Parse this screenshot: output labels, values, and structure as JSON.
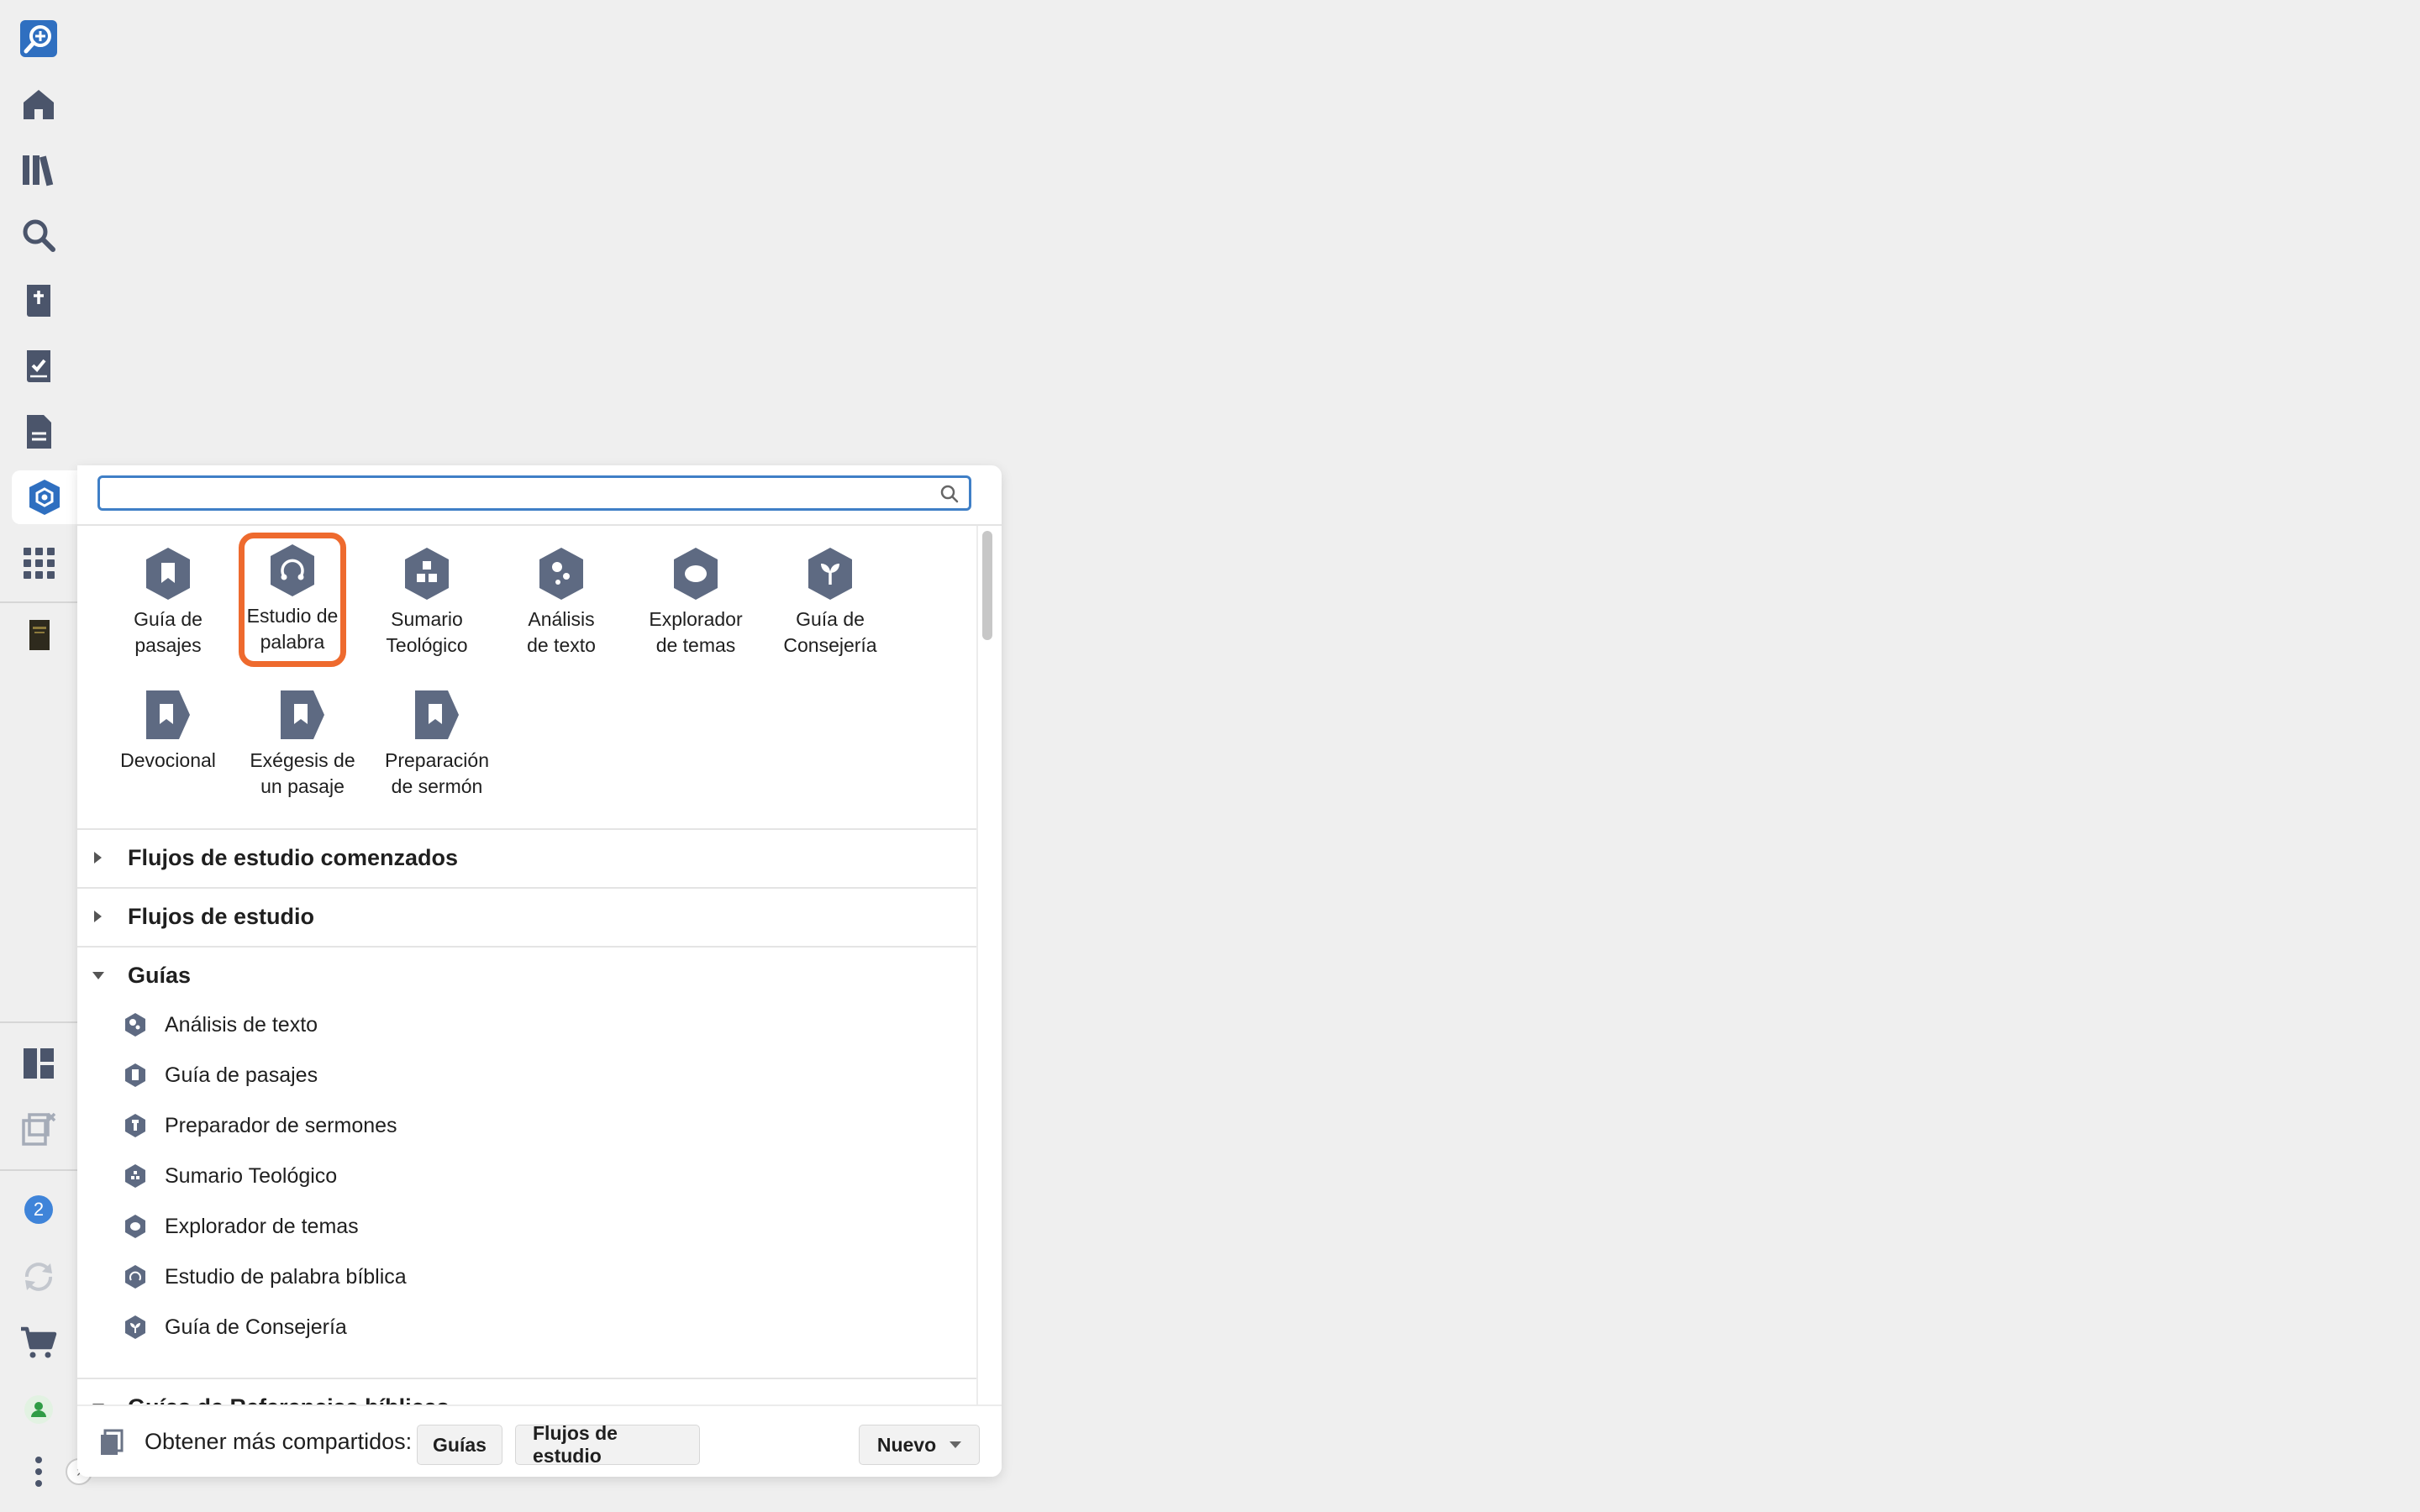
{
  "rail": {
    "items": [
      {
        "icon": "logos-search-app-icon"
      },
      {
        "icon": "home-icon"
      },
      {
        "icon": "library-icon"
      },
      {
        "icon": "search-icon"
      },
      {
        "icon": "bible-icon"
      },
      {
        "icon": "checklist-icon"
      },
      {
        "icon": "document-icon"
      },
      {
        "icon": "guides-icon"
      },
      {
        "icon": "apps-grid-icon"
      },
      {
        "icon": "book-cover-icon"
      },
      {
        "icon": "layouts-icon"
      },
      {
        "icon": "close-panels-icon"
      },
      {
        "icon": "notifications-icon"
      },
      {
        "icon": "sync-icon"
      },
      {
        "icon": "cart-icon"
      },
      {
        "icon": "user-icon"
      },
      {
        "icon": "more-icon"
      }
    ],
    "notifications_count": "2",
    "expand_glyph": "›"
  },
  "panel": {
    "search": {
      "value": "",
      "placeholder": ""
    },
    "tiles": [
      {
        "line1": "Guía de",
        "line2": "pasajes",
        "icon": "passage-guide-icon"
      },
      {
        "line1": "Estudio de",
        "line2": "palabra",
        "icon": "word-study-icon"
      },
      {
        "line1": "Sumario",
        "line2": "Teológico",
        "icon": "theology-summary-icon"
      },
      {
        "line1": "Análisis",
        "line2": "de texto",
        "icon": "text-analysis-icon"
      },
      {
        "line1": "Explorador",
        "line2": "de temas",
        "icon": "topic-explorer-icon"
      },
      {
        "line1": "Guía de",
        "line2": "Consejería",
        "icon": "counseling-guide-icon"
      },
      {
        "line1": "Devocional",
        "line2": "",
        "icon": "devotional-icon"
      },
      {
        "line1": "Exégesis de",
        "line2": "un pasaje",
        "icon": "exegesis-icon"
      },
      {
        "line1": "Preparación",
        "line2": "de sermón",
        "icon": "sermon-prep-icon"
      }
    ],
    "sections": {
      "started": "Flujos de estudio comenzados",
      "workflows": "Flujos de estudio",
      "guides": "Guías",
      "bible_refs": "Guías de Referencias bíblicas"
    },
    "guides": [
      "Análisis de texto",
      "Guía de pasajes",
      "Preparador de sermones",
      "Sumario Teológico",
      "Explorador de temas",
      "Estudio de palabra bíblica",
      "Guía de Consejería"
    ],
    "footer": {
      "label": "Obtener más compartidos:",
      "guides_button": "Guías",
      "workflows_button": "Flujos de estudio",
      "new_button": "Nuevo"
    }
  },
  "colors": {
    "accent": "#3f7fc6",
    "highlight": "#ee6a2e",
    "icon": "#5e6a82",
    "rail_icon": "#4b556b"
  }
}
